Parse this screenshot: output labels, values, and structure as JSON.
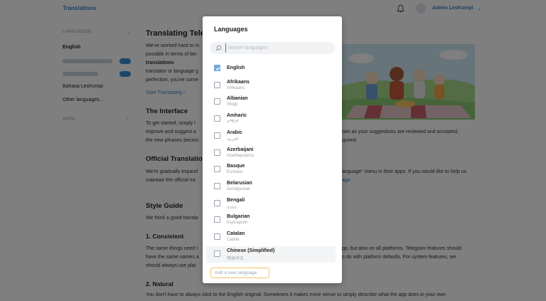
{
  "header": {
    "brand": "Translations",
    "user_name": "Admin LesKompi"
  },
  "sidebar": {
    "languages_heading": "LANGUAGES",
    "items": [
      {
        "label": "English"
      },
      {
        "label": "Bahasa LesKompi"
      },
      {
        "label": "Other languages..."
      }
    ],
    "apps_heading": "APPS"
  },
  "article": {
    "title": "Translating Teleg",
    "intro_lines": [
      "We've worked hard to m",
      "possible in terms of lan",
      "translations into the res",
      "translator or language g",
      "perfection, you've come"
    ],
    "intro_bold": "translations",
    "start_link": "Start Translating",
    "interface_heading": "The Interface",
    "interface_lines": [
      "To get started, simply l",
      "improve and suggest a",
      "the new phrases becom"
    ],
    "interface_right": [
      "oon as your suggestions are reviewed and accepted,",
      "quired."
    ],
    "official_heading": "Official Translation",
    "official_lines": [
      "We're gradually expand",
      "maintain the official tra"
    ],
    "official_right": [
      "anguage\" menu in their apps. If you would like to help us",
      "age."
    ],
    "style_heading": "Style Guide",
    "style_line": "We think a good transla",
    "consistent_heading": "1. Consistent",
    "consistent_lines": [
      "The same things need t",
      "have the same names a",
      "should always use plat"
    ],
    "consistent_right": [
      "pp, but also on all platforms. Telegram features should",
      "o do with platform defaults. For system features, we"
    ],
    "natural_heading": "2. Natural",
    "natural_line": "You don't have to always stick to the English original. Sometimes it makes more sense to simply describe what the app does in your own"
  },
  "modal": {
    "title": "Languages",
    "search_placeholder": "Search languages",
    "languages": [
      {
        "name": "English",
        "native": "",
        "checked": true
      },
      {
        "name": "Afrikaans",
        "native": "Afrikaans",
        "checked": false
      },
      {
        "name": "Albanian",
        "native": "Shqip",
        "checked": false
      },
      {
        "name": "Amharic",
        "native": "አማርኛ",
        "checked": false
      },
      {
        "name": "Arabic",
        "native": "العربية",
        "checked": false
      },
      {
        "name": "Azerbaijani",
        "native": "Azərbaycanca",
        "checked": false
      },
      {
        "name": "Basque",
        "native": "Euskara",
        "checked": false
      },
      {
        "name": "Belarusian",
        "native": "Беларуская",
        "checked": false
      },
      {
        "name": "Bengali",
        "native": "বাংলা",
        "checked": false
      },
      {
        "name": "Bulgarian",
        "native": "Български",
        "checked": false
      },
      {
        "name": "Catalan",
        "native": "Català",
        "checked": false
      },
      {
        "name": "Chinese (Simplified)",
        "native": "简体中文",
        "checked": false
      }
    ],
    "add_button": "Add a new language"
  },
  "colors": {
    "accent": "#3a7fbf",
    "checkbox_checked": "#6ea9dc",
    "add_button_border": "#f0c36d"
  }
}
